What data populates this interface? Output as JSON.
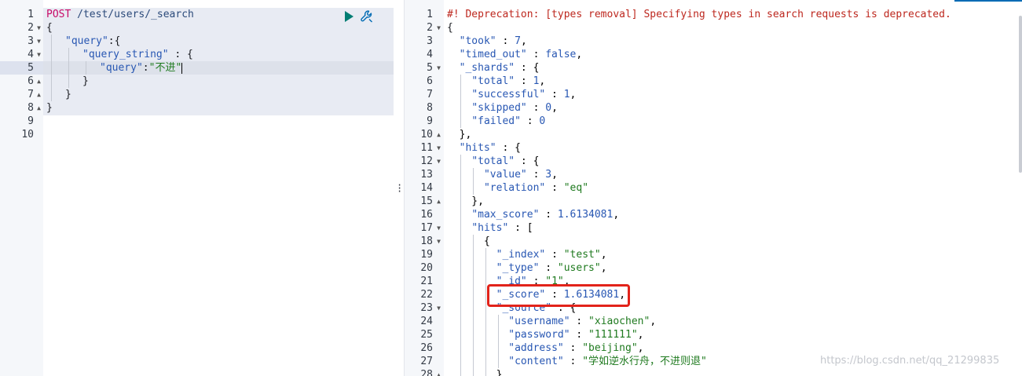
{
  "request": {
    "method": "POST",
    "path": "/test/users/_search",
    "line_numbers": [
      "1",
      "2",
      "3",
      "4",
      "5",
      "6",
      "7",
      "8",
      "9",
      "10"
    ],
    "body_tokens": {
      "l2_open": "{",
      "l3_key": "\"query\"",
      "l3_rest": ":{",
      "l4_key": "\"query_string\"",
      "l4_rest": " : {",
      "l5_key": "\"query\"",
      "l5_colon": ":",
      "l5_value": "\"不进\"",
      "l6_close": "}",
      "l7_close": "}",
      "l8_close": "}"
    },
    "run_button_icon": "play-icon",
    "settings_button_icon": "wrench-icon"
  },
  "response": {
    "deprecation_warning": "#! Deprecation: [types removal] Specifying types in search requests is deprecated.",
    "line_numbers": [
      "1",
      "2",
      "3",
      "4",
      "5",
      "6",
      "7",
      "8",
      "9",
      "10",
      "11",
      "12",
      "13",
      "14",
      "15",
      "16",
      "17",
      "18",
      "19",
      "20",
      "21",
      "22",
      "23",
      "24",
      "25",
      "26",
      "27",
      "28"
    ],
    "fields": {
      "took_key": "\"took\"",
      "took_value": "7",
      "timed_out_key": "\"timed_out\"",
      "timed_out_value": "false",
      "shards_key": "\"_shards\"",
      "total_key": "\"total\"",
      "total_value": "1",
      "successful_key": "\"successful\"",
      "successful_value": "1",
      "skipped_key": "\"skipped\"",
      "skipped_value": "0",
      "failed_key": "\"failed\"",
      "failed_value": "0",
      "hits_key": "\"hits\"",
      "hits_total_key": "\"total\"",
      "value_key": "\"value\"",
      "value_value": "3",
      "relation_key": "\"relation\"",
      "relation_value": "\"eq\"",
      "max_score_key": "\"max_score\"",
      "max_score_value": "1.6134081",
      "inner_hits_key": "\"hits\"",
      "index_key": "\"_index\"",
      "index_value": "\"test\"",
      "type_key": "\"_type\"",
      "type_value": "\"users\"",
      "id_key": "\"_id\"",
      "id_value": "\"1\"",
      "score_key": "\"_score\"",
      "score_value": "1.6134081",
      "source_key": "\"_source\"",
      "username_key": "\"username\"",
      "username_value": "\"xiaochen\"",
      "password_key": "\"password\"",
      "password_value": "\"111111\"",
      "address_key": "\"address\"",
      "address_value": "\"beijing\"",
      "content_key": "\"content\"",
      "content_value": "\"学如逆水行舟，不进则退\""
    }
  },
  "watermark": "https://blog.csdn.net/qq_21299835",
  "colors": {
    "accent": "#006bb4",
    "run_button": "#017d73",
    "highlight_box": "#e2231a"
  }
}
